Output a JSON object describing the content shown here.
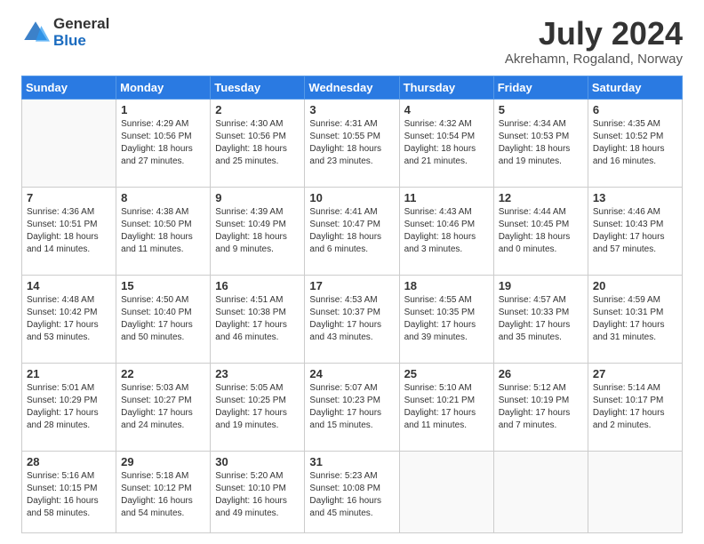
{
  "logo": {
    "general": "General",
    "blue": "Blue"
  },
  "header": {
    "title": "July 2024",
    "subtitle": "Akrehamn, Rogaland, Norway"
  },
  "weekdays": [
    "Sunday",
    "Monday",
    "Tuesday",
    "Wednesday",
    "Thursday",
    "Friday",
    "Saturday"
  ],
  "weeks": [
    [
      {
        "day": "",
        "info": ""
      },
      {
        "day": "1",
        "info": "Sunrise: 4:29 AM\nSunset: 10:56 PM\nDaylight: 18 hours\nand 27 minutes."
      },
      {
        "day": "2",
        "info": "Sunrise: 4:30 AM\nSunset: 10:56 PM\nDaylight: 18 hours\nand 25 minutes."
      },
      {
        "day": "3",
        "info": "Sunrise: 4:31 AM\nSunset: 10:55 PM\nDaylight: 18 hours\nand 23 minutes."
      },
      {
        "day": "4",
        "info": "Sunrise: 4:32 AM\nSunset: 10:54 PM\nDaylight: 18 hours\nand 21 minutes."
      },
      {
        "day": "5",
        "info": "Sunrise: 4:34 AM\nSunset: 10:53 PM\nDaylight: 18 hours\nand 19 minutes."
      },
      {
        "day": "6",
        "info": "Sunrise: 4:35 AM\nSunset: 10:52 PM\nDaylight: 18 hours\nand 16 minutes."
      }
    ],
    [
      {
        "day": "7",
        "info": "Sunrise: 4:36 AM\nSunset: 10:51 PM\nDaylight: 18 hours\nand 14 minutes."
      },
      {
        "day": "8",
        "info": "Sunrise: 4:38 AM\nSunset: 10:50 PM\nDaylight: 18 hours\nand 11 minutes."
      },
      {
        "day": "9",
        "info": "Sunrise: 4:39 AM\nSunset: 10:49 PM\nDaylight: 18 hours\nand 9 minutes."
      },
      {
        "day": "10",
        "info": "Sunrise: 4:41 AM\nSunset: 10:47 PM\nDaylight: 18 hours\nand 6 minutes."
      },
      {
        "day": "11",
        "info": "Sunrise: 4:43 AM\nSunset: 10:46 PM\nDaylight: 18 hours\nand 3 minutes."
      },
      {
        "day": "12",
        "info": "Sunrise: 4:44 AM\nSunset: 10:45 PM\nDaylight: 18 hours\nand 0 minutes."
      },
      {
        "day": "13",
        "info": "Sunrise: 4:46 AM\nSunset: 10:43 PM\nDaylight: 17 hours\nand 57 minutes."
      }
    ],
    [
      {
        "day": "14",
        "info": "Sunrise: 4:48 AM\nSunset: 10:42 PM\nDaylight: 17 hours\nand 53 minutes."
      },
      {
        "day": "15",
        "info": "Sunrise: 4:50 AM\nSunset: 10:40 PM\nDaylight: 17 hours\nand 50 minutes."
      },
      {
        "day": "16",
        "info": "Sunrise: 4:51 AM\nSunset: 10:38 PM\nDaylight: 17 hours\nand 46 minutes."
      },
      {
        "day": "17",
        "info": "Sunrise: 4:53 AM\nSunset: 10:37 PM\nDaylight: 17 hours\nand 43 minutes."
      },
      {
        "day": "18",
        "info": "Sunrise: 4:55 AM\nSunset: 10:35 PM\nDaylight: 17 hours\nand 39 minutes."
      },
      {
        "day": "19",
        "info": "Sunrise: 4:57 AM\nSunset: 10:33 PM\nDaylight: 17 hours\nand 35 minutes."
      },
      {
        "day": "20",
        "info": "Sunrise: 4:59 AM\nSunset: 10:31 PM\nDaylight: 17 hours\nand 31 minutes."
      }
    ],
    [
      {
        "day": "21",
        "info": "Sunrise: 5:01 AM\nSunset: 10:29 PM\nDaylight: 17 hours\nand 28 minutes."
      },
      {
        "day": "22",
        "info": "Sunrise: 5:03 AM\nSunset: 10:27 PM\nDaylight: 17 hours\nand 24 minutes."
      },
      {
        "day": "23",
        "info": "Sunrise: 5:05 AM\nSunset: 10:25 PM\nDaylight: 17 hours\nand 19 minutes."
      },
      {
        "day": "24",
        "info": "Sunrise: 5:07 AM\nSunset: 10:23 PM\nDaylight: 17 hours\nand 15 minutes."
      },
      {
        "day": "25",
        "info": "Sunrise: 5:10 AM\nSunset: 10:21 PM\nDaylight: 17 hours\nand 11 minutes."
      },
      {
        "day": "26",
        "info": "Sunrise: 5:12 AM\nSunset: 10:19 PM\nDaylight: 17 hours\nand 7 minutes."
      },
      {
        "day": "27",
        "info": "Sunrise: 5:14 AM\nSunset: 10:17 PM\nDaylight: 17 hours\nand 2 minutes."
      }
    ],
    [
      {
        "day": "28",
        "info": "Sunrise: 5:16 AM\nSunset: 10:15 PM\nDaylight: 16 hours\nand 58 minutes."
      },
      {
        "day": "29",
        "info": "Sunrise: 5:18 AM\nSunset: 10:12 PM\nDaylight: 16 hours\nand 54 minutes."
      },
      {
        "day": "30",
        "info": "Sunrise: 5:20 AM\nSunset: 10:10 PM\nDaylight: 16 hours\nand 49 minutes."
      },
      {
        "day": "31",
        "info": "Sunrise: 5:23 AM\nSunset: 10:08 PM\nDaylight: 16 hours\nand 45 minutes."
      },
      {
        "day": "",
        "info": ""
      },
      {
        "day": "",
        "info": ""
      },
      {
        "day": "",
        "info": ""
      }
    ]
  ]
}
